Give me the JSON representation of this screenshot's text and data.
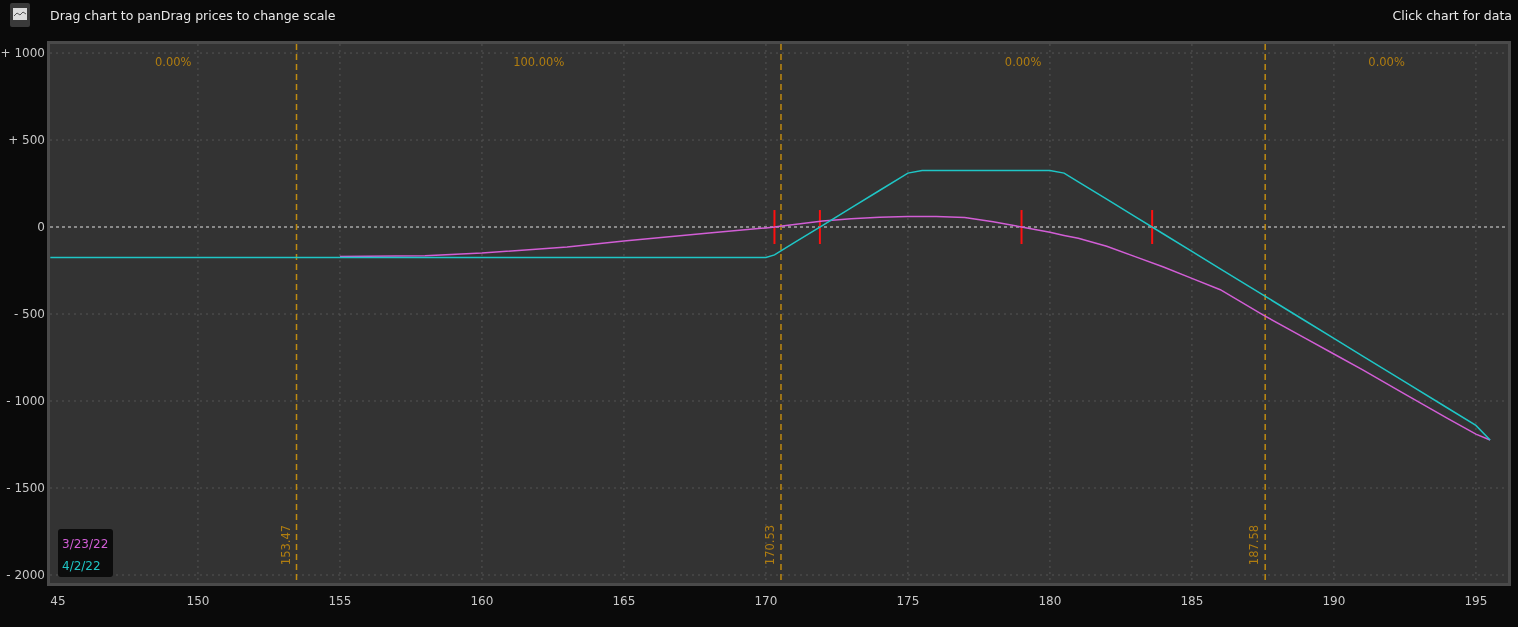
{
  "header": {
    "hint": "Drag chart to panDrag prices to change scale",
    "action": "Click chart for data"
  },
  "chart": {
    "clipped_tick_label": "45",
    "chart_data": {
      "type": "line",
      "x": [
        144.8,
        150,
        155,
        158,
        160,
        163,
        165,
        168,
        170,
        170.3,
        170.5,
        171,
        172,
        173,
        174,
        175,
        175.5,
        176,
        177,
        178,
        179,
        180,
        180.5,
        181,
        182,
        183,
        184,
        185,
        186,
        187.5,
        189,
        190,
        191,
        192.5,
        194,
        195,
        195.5
      ],
      "series": [
        {
          "name": "3/23/22",
          "color": "#d25ed6",
          "values": [
            null,
            null,
            -170,
            -165,
            -150,
            -115,
            -80,
            -35,
            -5,
            0,
            5,
            15,
            35,
            48,
            56,
            60,
            60,
            60,
            55,
            30,
            0,
            -30,
            -48,
            -65,
            -110,
            -170,
            -230,
            -295,
            -360,
            -505,
            -640,
            -730,
            -820,
            -960,
            -1100,
            -1190,
            -1224
          ]
        },
        {
          "name": "4/2/22",
          "color": "#1fc6c6",
          "values": [
            -175,
            -175,
            -175,
            -175,
            -175,
            -175,
            -175,
            -175,
            -175,
            -160,
            -140,
            -90,
            10,
            110,
            210,
            310,
            325,
            325,
            325,
            325,
            325,
            325,
            310,
            260,
            160,
            60,
            -40,
            -140,
            -240,
            -390,
            -540,
            -640,
            -740,
            -890,
            -1040,
            -1140,
            -1224
          ]
        }
      ],
      "xlim": [
        144.79,
        196.13
      ],
      "ylim": [
        -2046,
        1052
      ],
      "xticks": [
        150,
        155,
        160,
        165,
        170,
        175,
        180,
        185,
        190,
        195
      ],
      "yticks": [
        {
          "value": 1000,
          "label": "+ 1000"
        },
        {
          "value": 500,
          "label": "+ 500"
        },
        0,
        {
          "value": -500,
          "label": "- 500"
        },
        {
          "value": -1000,
          "label": "- 1000"
        },
        {
          "value": -1500,
          "label": "- 1500"
        },
        {
          "value": -2000,
          "label": "- 2000"
        }
      ],
      "grid": true,
      "ref_lines": [
        {
          "axis": "y",
          "value": 0
        },
        {
          "axis": "x",
          "value": 153.47,
          "label": "153.47"
        },
        {
          "axis": "x",
          "value": 170.53,
          "label": "170.53"
        },
        {
          "axis": "x",
          "value": 187.58,
          "label": "187.58"
        }
      ],
      "annotations": [
        "0.00%",
        "100.00%",
        "0.00%",
        "0.00%"
      ]
    }
  }
}
